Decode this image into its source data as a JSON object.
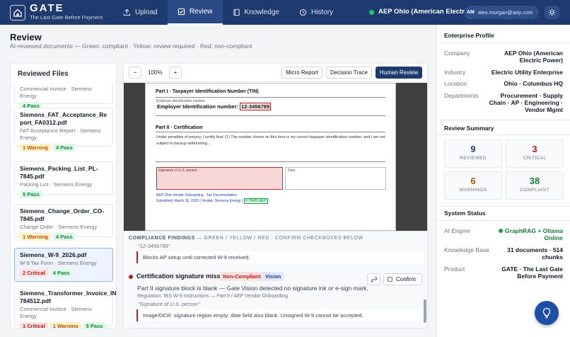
{
  "app": {
    "name": "GATE",
    "tagline": "The Last Gate Before Payment"
  },
  "nav": {
    "items": [
      {
        "label": "Upload",
        "icon": "upload-icon"
      },
      {
        "label": "Review",
        "icon": "check-square-icon",
        "active": true
      },
      {
        "label": "Knowledge",
        "icon": "book-icon"
      },
      {
        "label": "History",
        "icon": "clock-icon"
      }
    ],
    "company": "AEP Ohio (American Electric ...",
    "user_initials": "AM",
    "user_email": "alex.morgan@aep.com"
  },
  "page": {
    "title": "Review",
    "subtitle": "AI-reviewed documents — Green: compliant · Yellow: review required · Red: non-compliant"
  },
  "files": {
    "heading": "Reviewed Files",
    "items": [
      {
        "name": "",
        "meta": "Commercial Invoice · Siemens Energy",
        "badges": [
          {
            "text": "4 Pass",
            "kind": "pass"
          }
        ]
      },
      {
        "name": "Siemens_FAT_Acceptance_Report_FA0312.pdf",
        "meta": "FAT Acceptance Report · Siemens Energy",
        "badges": [
          {
            "text": "1 Warning",
            "kind": "warn"
          },
          {
            "text": "4 Pass",
            "kind": "pass"
          }
        ]
      },
      {
        "name": "Siemens_Packing_List_PL-7845.pdf",
        "meta": "Packing List · Siemens Energy",
        "badges": [
          {
            "text": "5 Pass",
            "kind": "pass"
          }
        ]
      },
      {
        "name": "Siemens_Change_Order_CO-7845.pdf",
        "meta": "Change Order · Siemens Energy",
        "badges": [
          {
            "text": "1 Warning",
            "kind": "warn"
          },
          {
            "text": "4 Pass",
            "kind": "pass"
          }
        ]
      },
      {
        "name": "Siemens_W-9_2026.pdf",
        "meta": "W-9 Tax Form · Siemens Energy",
        "selected": true,
        "badges": [
          {
            "text": "2 Critical",
            "kind": "crit"
          },
          {
            "text": "4 Pass",
            "kind": "pass"
          }
        ]
      },
      {
        "name": "Siemens_Transformer_Invoice_INV-784512.pdf",
        "meta": "Commercial Invoice · Siemens Energy",
        "badges": [
          {
            "text": "1 Critical",
            "kind": "crit"
          },
          {
            "text": "1 Warning",
            "kind": "warn"
          },
          {
            "text": "5 Pass",
            "kind": "pass"
          }
        ]
      }
    ]
  },
  "viewer": {
    "zoom_out": "−",
    "zoom": "100%",
    "zoom_in": "+",
    "micro_report": "Micro Report",
    "decision_trace": "Decision Trace",
    "human_review": "Human Review"
  },
  "document": {
    "part1": "Part I · Taxpayer Identification Number (TIN)",
    "ein_label": "Employer identification number",
    "ein_text": "Employer Identification number:",
    "ein_value": "12-3456789",
    "part2": "Part II · Certification",
    "cert_text_1": "Under penalties of perjury, I certify that: (1) The number shown on this form is my correct taxpayer identification number, and I am not",
    "cert_text_2": "subject to backup withholding...",
    "sig_label": "Signature of U.S. person",
    "date_label": "Date",
    "footer_1": "AEP Ohio Vendor Onboarding · Tax Documentation",
    "footer_2": "Submitted: March 16, 2026 | Vendor: Siemens Energy |",
    "vendor_id": "V-78453-AEP"
  },
  "findings": {
    "heading": "COMPLIANCE FINDINGS",
    "heading_rest": " — GREEN / YELLOW / RED · CONFIRM CHECKBOXES BELOW",
    "quote_1": "\"12-3456789\"",
    "note_1": "Blocks AP setup until corrected W-9 received.",
    "title_2": "Certification signature missing",
    "status_2": "Non-Compliant",
    "source_2": "Vision",
    "desc_2": "Part II signature block is blank — Gate Vision detected no signature ink or e-sign mark.",
    "reg_2": "Regulation: IRS W-9 Instructions — Part II / AEP Vendor Onboarding",
    "quote_2": "\"Signature of U.S. person\"",
    "note_2": "Image/OCR: signature region empty; date field also blank. Unsigned W-9 cannot be accepted.",
    "confirm_label": "Confirm"
  },
  "profile": {
    "heading": "Enterprise Profile",
    "rows": [
      {
        "key": "Company",
        "value_1": "AEP Ohio (American",
        "value_2": "Electric Power)"
      },
      {
        "key": "Industry",
        "value_1": "Electric Utility Enterprise"
      },
      {
        "key": "Location",
        "value_1": "Ohio · Columbus HQ"
      },
      {
        "key": "Departments",
        "value_1": "Procurement · Supply",
        "value_2": "Chain · AP · Engineering ·",
        "value_3": "Vendor Mgmt"
      }
    ]
  },
  "summary": {
    "heading": "Review Summary",
    "stats": [
      {
        "num": "9",
        "label": "REVIEWED",
        "color": "#1e3a6e"
      },
      {
        "num": "3",
        "label": "CRITICAL",
        "color": "#b91c1c"
      },
      {
        "num": "6",
        "label": "WARNINGS",
        "color": "#b45309"
      },
      {
        "num": "38",
        "label": "COMPLIANT",
        "color": "#15803d"
      }
    ]
  },
  "system": {
    "heading": "System Status",
    "ai_key": "AI Engine",
    "ai_value_1": "GraphRAG + Ollama",
    "ai_value_2": "Online",
    "kb_key": "Knowledge Base",
    "kb_value_1": "31 documents · 514",
    "kb_value_2": "chunks",
    "product_key": "Product",
    "product_value_1": "GATE · The Last Gate",
    "product_value_2": "Before Payment"
  }
}
